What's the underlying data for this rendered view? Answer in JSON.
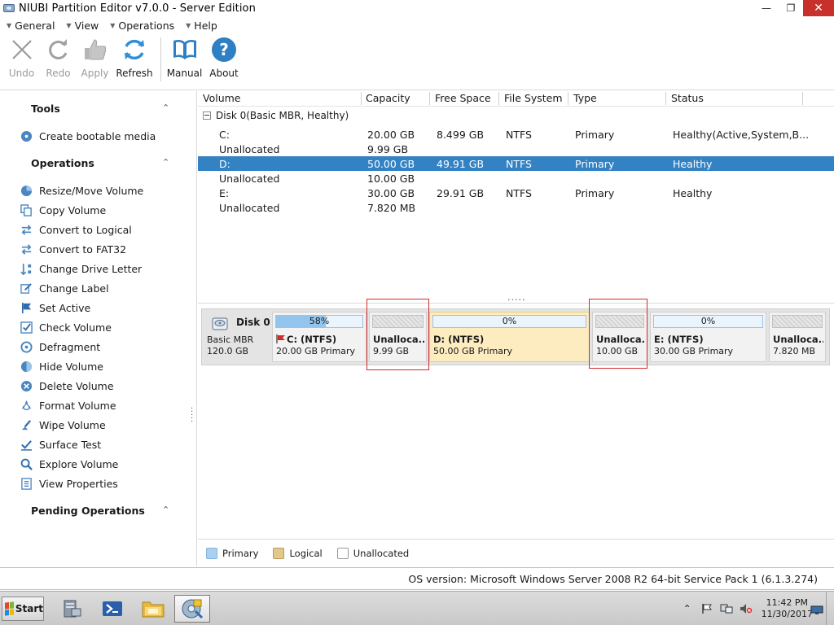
{
  "window": {
    "title": "NIUBI Partition Editor v7.0.0 - Server Edition"
  },
  "menu": [
    {
      "label": "General"
    },
    {
      "label": "View"
    },
    {
      "label": "Operations"
    },
    {
      "label": "Help"
    }
  ],
  "toolbar": {
    "undo": "Undo",
    "redo": "Redo",
    "apply": "Apply",
    "refresh": "Refresh",
    "manual": "Manual",
    "about": "About"
  },
  "sidebar": {
    "tools_title": "Tools",
    "create_bootable": "Create bootable media",
    "operations_title": "Operations",
    "operations": [
      {
        "label": "Resize/Move Volume",
        "icon": "resize-icon"
      },
      {
        "label": "Copy Volume",
        "icon": "copy-icon"
      },
      {
        "label": "Convert to Logical",
        "icon": "convert-icon"
      },
      {
        "label": "Convert to FAT32",
        "icon": "convert-fat-icon"
      },
      {
        "label": "Change Drive Letter",
        "icon": "drive-letter-icon"
      },
      {
        "label": "Change Label",
        "icon": "label-icon"
      },
      {
        "label": "Set Active",
        "icon": "flag-icon"
      },
      {
        "label": "Check Volume",
        "icon": "check-icon"
      },
      {
        "label": "Defragment",
        "icon": "defrag-icon"
      },
      {
        "label": "Hide Volume",
        "icon": "hide-icon"
      },
      {
        "label": "Delete Volume",
        "icon": "delete-icon"
      },
      {
        "label": "Format Volume",
        "icon": "format-icon"
      },
      {
        "label": "Wipe Volume",
        "icon": "wipe-icon"
      },
      {
        "label": "Surface Test",
        "icon": "surface-test-icon"
      },
      {
        "label": "Explore Volume",
        "icon": "explore-icon"
      },
      {
        "label": "View Properties",
        "icon": "properties-icon"
      }
    ],
    "pending_title": "Pending Operations"
  },
  "table": {
    "columns": [
      "Volume",
      "Capacity",
      "Free Space",
      "File System",
      "Type",
      "Status"
    ],
    "disk_label": "Disk 0(Basic MBR, Healthy)",
    "rows": [
      {
        "volume": "C:",
        "capacity": "20.00 GB",
        "free": "8.499 GB",
        "fs": "NTFS",
        "type": "Primary",
        "status": "Healthy(Active,System,B...",
        "selected": false
      },
      {
        "volume": "Unallocated",
        "capacity": "9.99 GB",
        "free": "",
        "fs": "",
        "type": "",
        "status": "",
        "selected": false
      },
      {
        "volume": "D:",
        "capacity": "50.00 GB",
        "free": "49.91 GB",
        "fs": "NTFS",
        "type": "Primary",
        "status": "Healthy",
        "selected": true
      },
      {
        "volume": "Unallocated",
        "capacity": "10.00 GB",
        "free": "",
        "fs": "",
        "type": "",
        "status": "",
        "selected": false
      },
      {
        "volume": "E:",
        "capacity": "30.00 GB",
        "free": "29.91 GB",
        "fs": "NTFS",
        "type": "Primary",
        "status": "Healthy",
        "selected": false
      },
      {
        "volume": "Unallocated",
        "capacity": "7.820 MB",
        "free": "",
        "fs": "",
        "type": "",
        "status": "",
        "selected": false
      }
    ],
    "splitter": "....."
  },
  "diskmap": {
    "disk": {
      "name": "Disk 0",
      "type": "Basic MBR",
      "size": "120.0 GB"
    },
    "partitions": [
      {
        "kind": "primary",
        "pct": "58%",
        "used": 0.58,
        "name": "C: (NTFS)",
        "info": "20.00 GB Primary",
        "flag": true
      },
      {
        "kind": "unalloc",
        "pct": "",
        "used": 0,
        "name": "Unalloca...",
        "info": "9.99 GB",
        "flag": false
      },
      {
        "kind": "logical",
        "pct": "0%",
        "used": 0,
        "name": "D: (NTFS)",
        "info": "50.00 GB Primary",
        "flag": false
      },
      {
        "kind": "unalloc",
        "pct": "",
        "used": 0,
        "name": "Unalloca...",
        "info": "10.00 GB",
        "flag": false
      },
      {
        "kind": "primary",
        "pct": "0%",
        "used": 0,
        "name": "E: (NTFS)",
        "info": "30.00 GB Primary",
        "flag": false
      },
      {
        "kind": "unalloc",
        "pct": "",
        "used": 0,
        "name": "Unalloca...",
        "info": "7.820 MB",
        "flag": false
      }
    ]
  },
  "legend": [
    {
      "label": "Primary",
      "color": "#a8d0f3"
    },
    {
      "label": "Logical",
      "color": "#e2c88c"
    },
    {
      "label": "Unallocated",
      "color": "#ffffff"
    }
  ],
  "status": {
    "os": "OS version: Microsoft Windows Server 2008 R2  64-bit Service Pack 1 (6.1.3.274)"
  },
  "taskbar": {
    "start": "Start",
    "time": "11:42 PM",
    "date": "11/30/2017"
  }
}
